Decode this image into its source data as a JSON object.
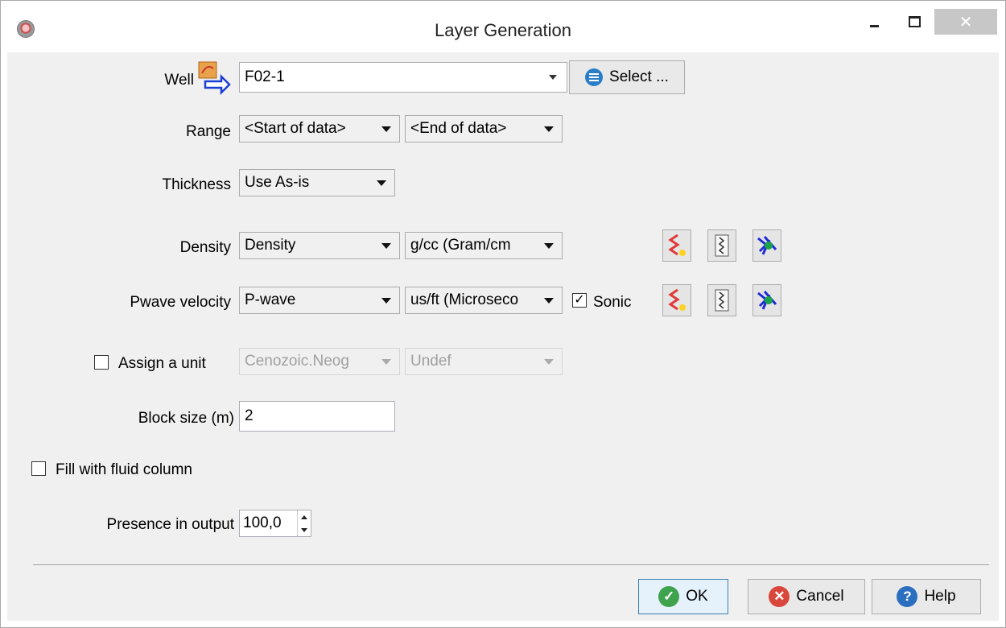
{
  "window": {
    "title": "Layer Generation",
    "close_glyph": "✕"
  },
  "well": {
    "label": "Well",
    "value": "F02-1",
    "select_label": "Select ..."
  },
  "range": {
    "label": "Range",
    "start": "<Start of data>",
    "end": "<End of data>"
  },
  "thickness": {
    "label": "Thickness",
    "value": "Use As-is"
  },
  "density": {
    "label": "Density",
    "value": "Density",
    "unit": "g/cc (Gram/cm"
  },
  "pwave": {
    "label": "Pwave velocity",
    "value": "P-wave",
    "unit": "us/ft (Microseco",
    "sonic_label": "Sonic",
    "sonic_checked": true,
    "check_glyph": "✓"
  },
  "assign_unit": {
    "label": "Assign a unit",
    "checked": false,
    "unit_value": "Cenozoic.Neog",
    "sub_value": "Undef"
  },
  "block_size": {
    "label": "Block size (m)",
    "value": "2"
  },
  "fill_fluid": {
    "label": "Fill with fluid column",
    "checked": false
  },
  "presence": {
    "label": "Presence in output",
    "value": "100,0"
  },
  "buttons": {
    "ok": "OK",
    "cancel": "Cancel",
    "help": "Help",
    "ok_glyph": "✓",
    "cancel_glyph": "✕",
    "help_glyph": "?"
  },
  "icons": {
    "well": "well-selector-icon",
    "select": "list-icon",
    "create_log": "create-log-icon",
    "log_view": "log-view-icon",
    "crossplot": "crossplot-icon"
  },
  "colors": {
    "ok_green": "#3fa34d",
    "cancel_red": "#d9473c",
    "help_blue": "#2c6fc0",
    "select_blue": "#2a7ec8"
  }
}
